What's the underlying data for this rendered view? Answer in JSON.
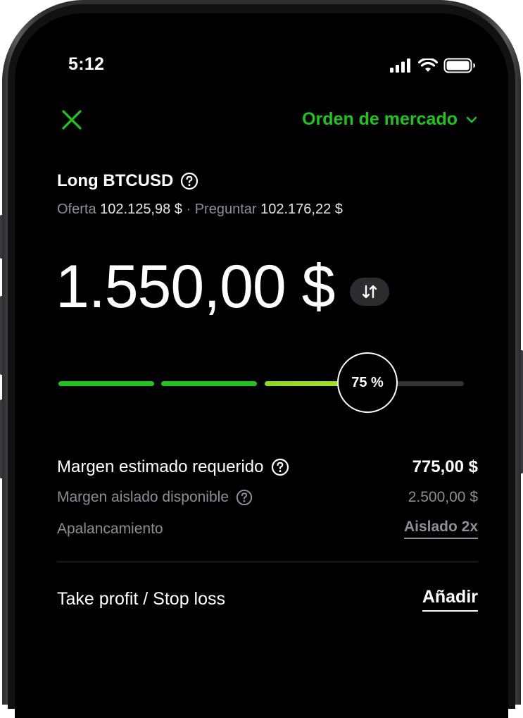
{
  "status_bar": {
    "time": "5:12"
  },
  "header": {
    "order_type": "Orden de mercado"
  },
  "pair": {
    "title": "Long BTCUSD"
  },
  "quote": {
    "bid_label": "Oferta",
    "bid_value": "102.125,98 $",
    "separator": "·",
    "ask_label": "Preguntar",
    "ask_value": "102.176,22 $"
  },
  "amount": {
    "value": "1.550,00 $"
  },
  "slider": {
    "label": "75 %",
    "fraction": 0.75
  },
  "details": {
    "margin_required_label": "Margen estimado requerido",
    "margin_required_value": "775,00 $",
    "isolated_margin_label": "Margen aislado disponible",
    "isolated_margin_value": "2.500,00 $",
    "leverage_label": "Apalancamiento",
    "leverage_value": "Aislado 2x"
  },
  "tpsl": {
    "label": "Take profit / Stop loss",
    "action": "Añadir"
  },
  "colors": {
    "accent_green": "#1ec51e",
    "lime": "#a6e22e",
    "background": "#000000"
  },
  "icons": [
    "close-icon",
    "chevron-down-icon",
    "help-icon",
    "swap-icon",
    "signal-icon",
    "wifi-icon",
    "battery-icon"
  ]
}
